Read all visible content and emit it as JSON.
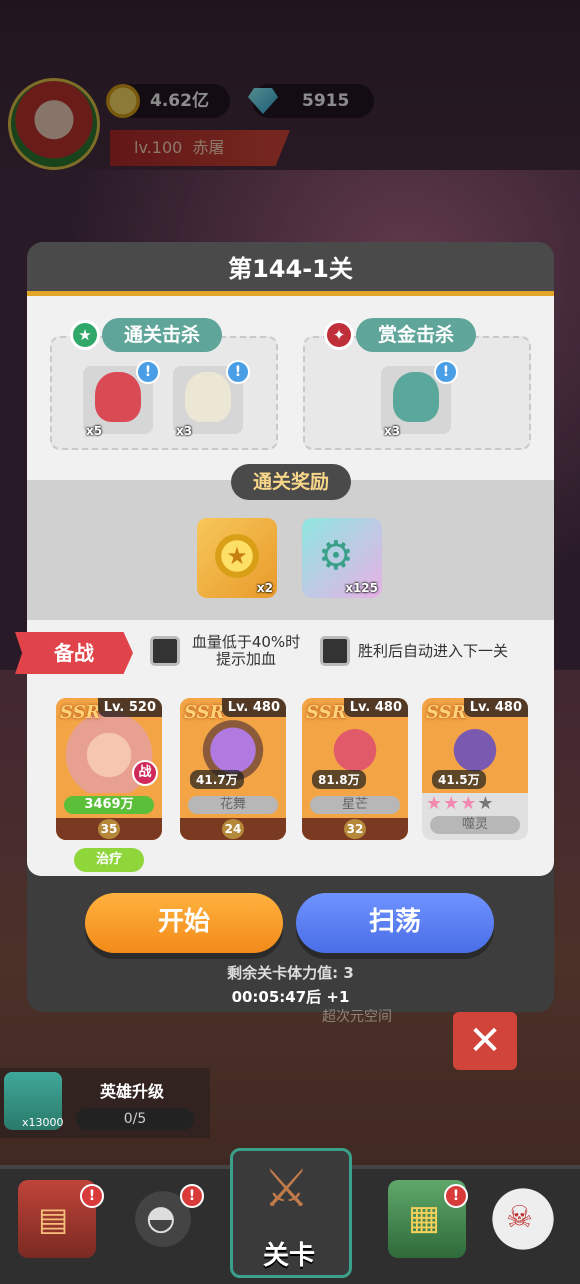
{
  "player": {
    "level": "lv.100",
    "name": "赤屠",
    "gold": "4.62亿",
    "gems": "5915"
  },
  "stage": {
    "title": "第144-1关",
    "clear_kill_label": "通关击杀",
    "bounty_kill_label": "赏金击杀",
    "clear_enemies": [
      {
        "name": "octopus",
        "count": "x5",
        "color": "#d94a55"
      },
      {
        "name": "white-ghost",
        "count": "x3",
        "color": "#ece7d5"
      }
    ],
    "bounty_enemies": [
      {
        "name": "lion-dancer",
        "count": "x3",
        "color": "#5aa89c"
      }
    ],
    "reward_title": "通关奖励",
    "rewards": [
      {
        "icon": "star-coin-icon",
        "count": "x2"
      },
      {
        "icon": "gear-icon",
        "count": "x125"
      }
    ]
  },
  "prep": {
    "label": "备战",
    "option1_line1": "血量低于40%时",
    "option1_line2": "提示加血",
    "option2": "胜利后自动进入下一关"
  },
  "heroes": [
    {
      "rarity": "SSR",
      "level": "Lv. 520",
      "bar": "3469万",
      "star": "35",
      "badge": "战",
      "tag": "治疗",
      "color": "#e8a090"
    },
    {
      "rarity": "SSR",
      "level": "Lv. 480",
      "power": "41.7万",
      "bar": "花舞",
      "star": "24",
      "color": "#a05fbf"
    },
    {
      "rarity": "SSR",
      "level": "Lv. 480",
      "power": "81.8万",
      "bar": "星芒",
      "star": "32",
      "color": "#d04a5a"
    },
    {
      "rarity": "SSR",
      "level": "Lv. 480",
      "power": "41.5万",
      "bar": "噬灵",
      "color": "#6a4fa0"
    }
  ],
  "actions": {
    "start": "开始",
    "sweep": "扫荡",
    "stamina": "剩余关卡体力值: 3",
    "timer": "00:05:47后 +1",
    "bg_text": "超次元空间"
  },
  "upgrade": {
    "label": "英雄升级",
    "progress": "0/5",
    "cost": "x13000"
  },
  "nav": {
    "stage_label": "关卡"
  }
}
